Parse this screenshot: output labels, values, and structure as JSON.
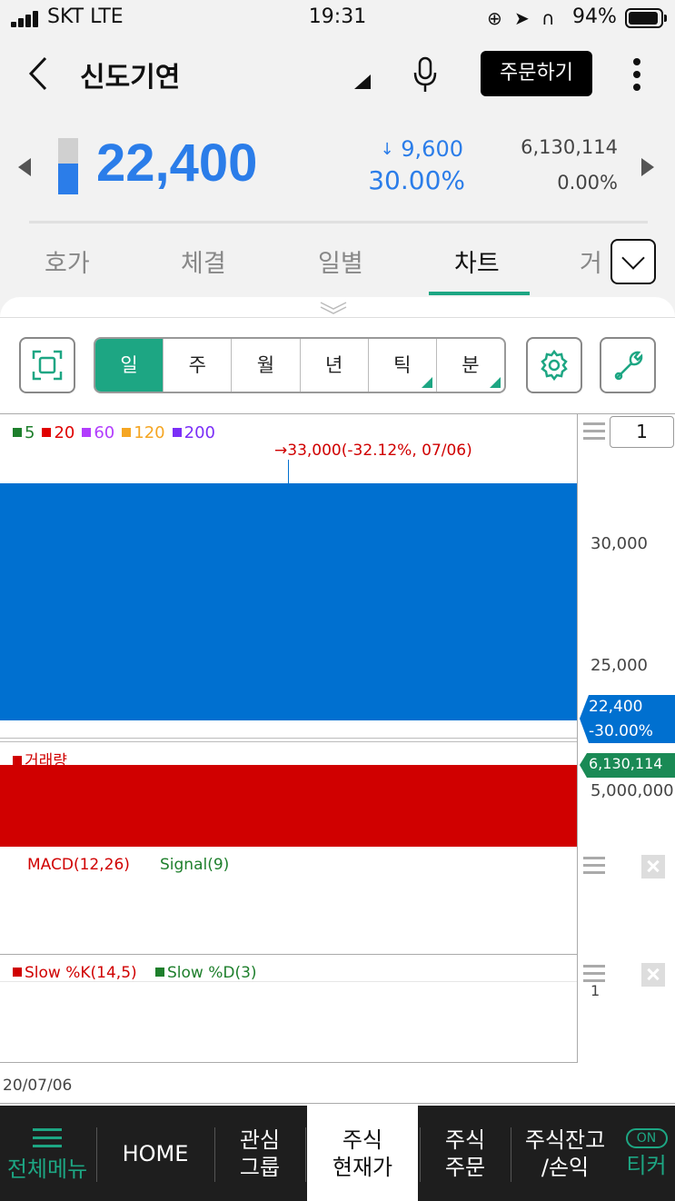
{
  "status_bar": {
    "carrier": "SKT  LTE",
    "time": "19:31",
    "battery": "94%"
  },
  "header": {
    "stock_name": "신도기연",
    "order_button": "주문하기"
  },
  "quote": {
    "price": "22,400",
    "change_arrow": "↓",
    "change": "9,600",
    "change_pct": "30.00%",
    "volume": "6,130,114",
    "volume_pct": "0.00%",
    "price_level_fraction": 0.55,
    "color_down": "#2b7de9"
  },
  "tabs": [
    {
      "label": "호가"
    },
    {
      "label": "체결"
    },
    {
      "label": "일별"
    },
    {
      "label": "차트"
    },
    {
      "label": "거"
    }
  ],
  "periods": [
    {
      "label": "일"
    },
    {
      "label": "주"
    },
    {
      "label": "월"
    },
    {
      "label": "년"
    },
    {
      "label": "틱"
    },
    {
      "label": "분"
    }
  ],
  "chart": {
    "ma_legend": [
      {
        "label": "5",
        "color": "#1e7f2c"
      },
      {
        "label": "20",
        "color": "#e00000"
      },
      {
        "label": "60",
        "color": "#b23cfd"
      },
      {
        "label": "120",
        "color": "#f5a623"
      },
      {
        "label": "200",
        "color": "#7b2ff7"
      }
    ],
    "high_annotation": "33,000(-32.12%, 07/06)",
    "high_arrow": "→",
    "price_axis": [
      "30,000",
      "25,000"
    ],
    "count_box": "1",
    "current_price_tag": "22,400",
    "current_pct_tag": "-30.00%",
    "volume_title": "거래량",
    "volume_tag": "6,130,114",
    "volume_axis": "5,000,000",
    "macd_label": "MACD(12,26)",
    "signal_label": "Signal(9)",
    "slowk_label": "Slow %K(14,5)",
    "slowd_label": "Slow %D(3)",
    "stoch_axis": "1",
    "date_label": "20/07/06",
    "candle_color": "#0070d0",
    "volume_color": "#d00000",
    "volume_tag_color": "#1a8a55"
  },
  "bottom_nav": {
    "menu": "전체메뉴",
    "home": "HOME",
    "watch_1": "관심",
    "watch_2": "그룹",
    "current_1": "주식",
    "current_2": "현재가",
    "order_1": "주식",
    "order_2": "주문",
    "balance_1": "주식잔고",
    "balance_2": "/손익",
    "ticker_toggle": "ON",
    "ticker": "티커"
  }
}
